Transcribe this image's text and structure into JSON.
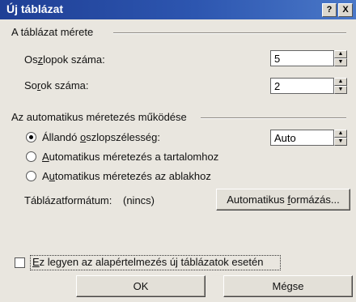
{
  "window": {
    "title": "Új táblázat",
    "help_label": "?",
    "close_label": "X"
  },
  "table_size": {
    "group_title": "A táblázat mérete",
    "columns_label_pre": "Os",
    "columns_label_acc": "z",
    "columns_label_post": "lopok száma:",
    "columns_value": "5",
    "rows_label_pre": "So",
    "rows_label_acc": "r",
    "rows_label_post": "ok száma:",
    "rows_value": "2"
  },
  "autofit": {
    "group_title": "Az automatikus méretezés működése",
    "fixed_label_pre": "Állandó ",
    "fixed_label_acc": "o",
    "fixed_label_post": "szlopszélesség:",
    "fixed_value": "Auto",
    "content_label_pre": "",
    "content_label_acc": "A",
    "content_label_post": "utomatikus méretezés a tartalomhoz",
    "window_label_pre": "A",
    "window_label_acc": "u",
    "window_label_post": "tomatikus méretezés az ablakhoz",
    "selected": "fixed"
  },
  "format": {
    "label": "Táblázatformátum:",
    "value": "(nincs)",
    "button_pre": "Automatikus ",
    "button_acc": "f",
    "button_post": "ormázás..."
  },
  "default_checkbox": {
    "label_pre": "",
    "label_acc": "E",
    "label_post": "z legyen az alapértelmezés új táblázatok esetén",
    "checked": false
  },
  "buttons": {
    "ok": "OK",
    "cancel": "Mégse"
  }
}
